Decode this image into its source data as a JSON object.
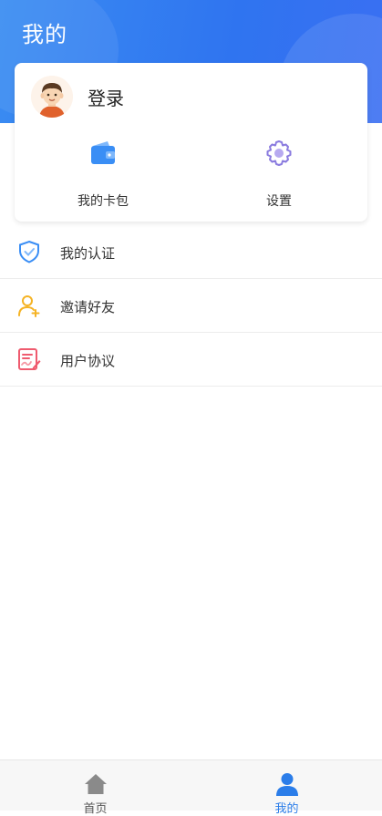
{
  "header": {
    "title": "我的"
  },
  "profile": {
    "login_label": "登录"
  },
  "shortcuts": [
    {
      "label": "我的卡包",
      "icon": "wallet-icon",
      "color": "#3a8ef5"
    },
    {
      "label": "设置",
      "icon": "gear-icon",
      "color": "#8a7bdf"
    }
  ],
  "menu": [
    {
      "label": "我的认证",
      "icon": "shield-check-icon",
      "color": "#3a8ef5"
    },
    {
      "label": "邀请好友",
      "icon": "add-user-icon",
      "color": "#f5b324"
    },
    {
      "label": "用户协议",
      "icon": "agreement-icon",
      "color": "#ef5b6f"
    }
  ],
  "tabbar": {
    "tabs": [
      {
        "label": "首页",
        "icon": "home-icon",
        "active": false
      },
      {
        "label": "我的",
        "icon": "user-icon",
        "active": true
      }
    ],
    "active_color": "#2b7de9",
    "inactive_color": "#8a8a8a"
  }
}
